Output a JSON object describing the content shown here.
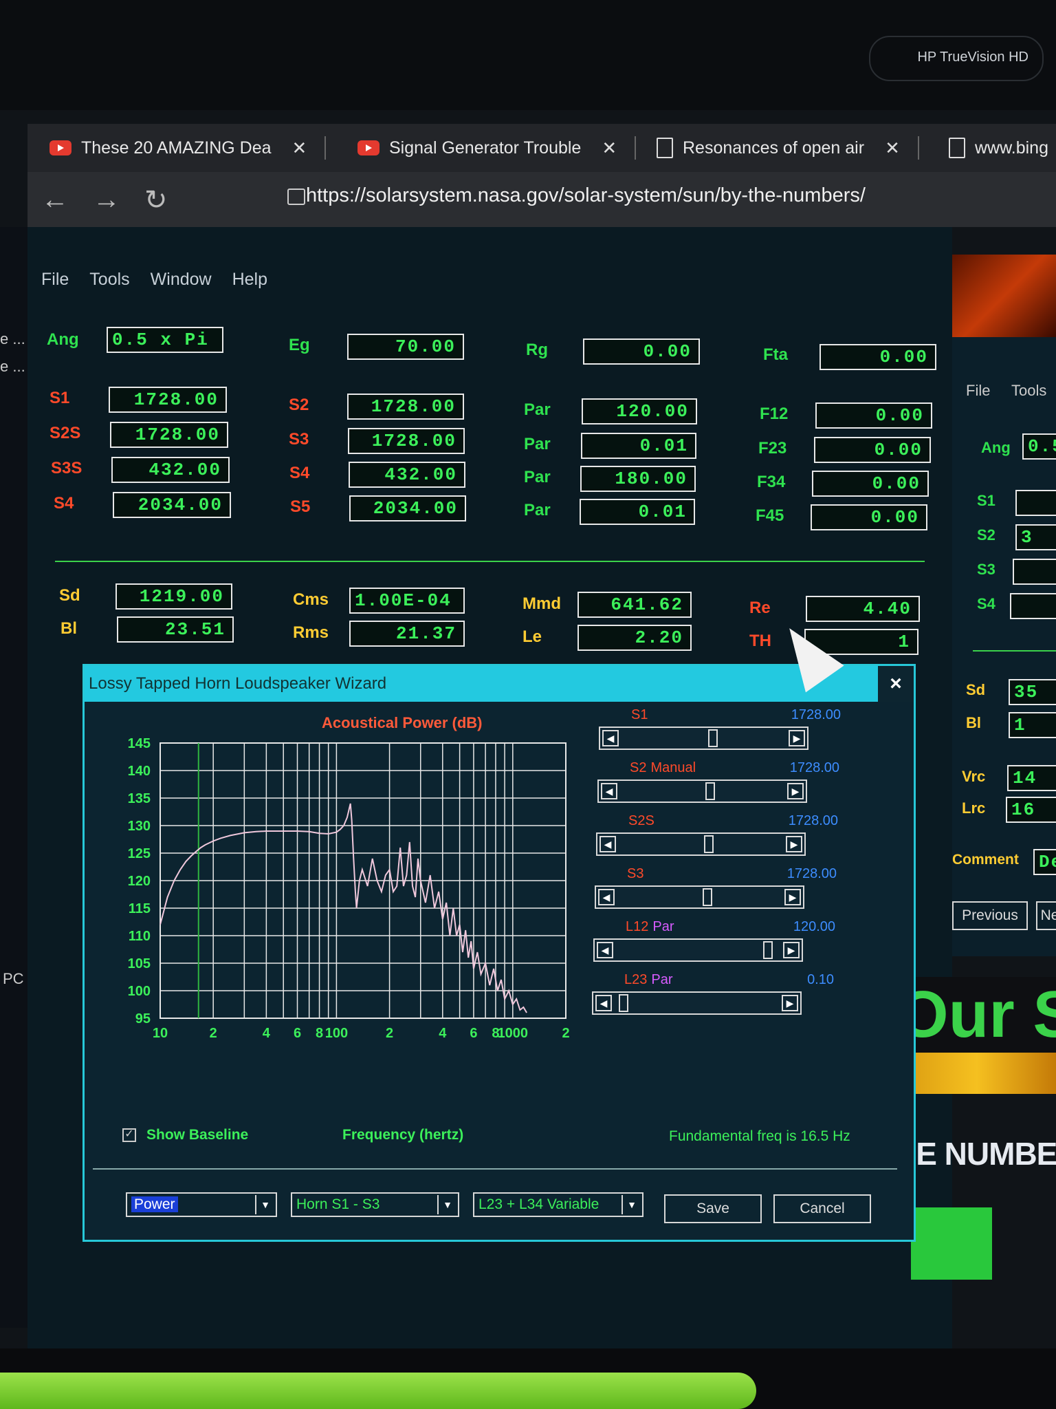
{
  "monitor": {
    "camera_label": "HP TrueVision HD"
  },
  "browser": {
    "tabs": [
      {
        "title": "These 20 AMAZING Dea"
      },
      {
        "title": "Signal Generator Trouble"
      },
      {
        "title": "Resonances of open air"
      },
      {
        "title": "www.bing"
      }
    ],
    "url": "https://solarsystem.nasa.gov/solar-system/sun/by-the-numbers/"
  },
  "left_strip": {
    "texts": [
      "e ...",
      "e ...",
      "PC"
    ]
  },
  "main_app": {
    "menu": [
      "File",
      "Tools",
      "Window",
      "Help"
    ],
    "params_row0": [
      {
        "label": "Ang",
        "value": "0.5 x Pi"
      },
      {
        "label": "Eg",
        "value": "70.00"
      },
      {
        "label": "Rg",
        "value": "0.00"
      },
      {
        "label": "Fta",
        "value": "0.00"
      }
    ],
    "col1": [
      {
        "label": "S1",
        "value": "1728.00"
      },
      {
        "label": "S2S",
        "value": "1728.00"
      },
      {
        "label": "S3S",
        "value": "432.00"
      },
      {
        "label": "S4",
        "value": "2034.00"
      }
    ],
    "col2": [
      {
        "label": "S2",
        "value": "1728.00"
      },
      {
        "label": "S3",
        "value": "1728.00"
      },
      {
        "label": "S4",
        "value": "432.00"
      },
      {
        "label": "S5",
        "value": "2034.00"
      }
    ],
    "col3": [
      {
        "label": "Par",
        "value": "120.00"
      },
      {
        "label": "Par",
        "value": "0.01"
      },
      {
        "label": "Par",
        "value": "180.00"
      },
      {
        "label": "Par",
        "value": "0.01"
      }
    ],
    "col4": [
      {
        "label": "F12",
        "value": "0.00"
      },
      {
        "label": "F23",
        "value": "0.00"
      },
      {
        "label": "F34",
        "value": "0.00"
      },
      {
        "label": "F45",
        "value": "0.00"
      }
    ],
    "driver": [
      {
        "label": "Sd",
        "value": "1219.00"
      },
      {
        "label": "Bl",
        "value": "23.51"
      },
      {
        "label": "Cms",
        "value": "1.00E-04"
      },
      {
        "label": "Rms",
        "value": "21.37"
      },
      {
        "label": "Mmd",
        "value": "641.62"
      },
      {
        "label": "Le",
        "value": "2.20"
      },
      {
        "label": "Re",
        "value": "4.40"
      },
      {
        "label": "TH",
        "value": "1"
      }
    ]
  },
  "right_app": {
    "menu": [
      "File",
      "Tools"
    ],
    "labels": [
      "Ang",
      "S1",
      "S2",
      "S3",
      "S4",
      "Sd",
      "Bl",
      "Vrc",
      "Lrc",
      "Comment"
    ],
    "values": [
      "0.5",
      "",
      "3",
      "",
      "",
      "35",
      "1",
      "14",
      "16",
      "De"
    ],
    "buttons": [
      "Previous",
      "Ne"
    ]
  },
  "website": {
    "banner": "Our S",
    "heading": "HE NUMBER"
  },
  "dialog": {
    "title": "Lossy Tapped Horn Loudspeaker Wizard",
    "close": "×",
    "show_baseline_label": "Show Baseline",
    "fundamental": "Fundamental freq is 16.5 Hz",
    "sliders": [
      {
        "label": "S1",
        "extra": "",
        "value": "1728.00",
        "position": 0.55
      },
      {
        "label": "S2",
        "extra": "Manual",
        "value": "1728.00",
        "position": 0.54
      },
      {
        "label": "S2S",
        "extra": "",
        "value": "1728.00",
        "position": 0.54
      },
      {
        "label": "S3",
        "extra": "",
        "value": "1728.00",
        "position": 0.54
      },
      {
        "label": "L12",
        "extra": "Par",
        "value": "120.00",
        "position": 0.93
      },
      {
        "label": "L23",
        "extra": "Par",
        "value": "0.10",
        "position": 0.03
      }
    ],
    "combos": [
      {
        "value": "Power"
      },
      {
        "value": "Horn S1 - S3"
      },
      {
        "value": "L23 + L34 Variable"
      }
    ],
    "save_label": "Save",
    "cancel_label": "Cancel"
  },
  "chart_data": {
    "type": "line",
    "title": "Acoustical Power (dB)",
    "xlabel": "Frequency (hertz)",
    "ylabel": "",
    "x_scale": "log",
    "xlim": [
      10,
      2000
    ],
    "ylim": [
      95,
      145
    ],
    "y_ticks": [
      145,
      140,
      135,
      130,
      125,
      120,
      115,
      110,
      105,
      100,
      95
    ],
    "x_tick_labels": [
      "10",
      "2",
      "4",
      "6",
      "8",
      "100",
      "2",
      "4",
      "6",
      "8",
      "1000",
      "2"
    ],
    "x_tick_values": [
      10,
      20,
      40,
      60,
      80,
      100,
      200,
      400,
      600,
      800,
      1000,
      2000
    ],
    "baseline_x": 16.5,
    "series": [
      {
        "x": [
          10,
          11,
          12,
          13,
          14,
          15,
          16,
          17,
          18,
          20,
          22,
          25,
          30,
          35,
          40,
          50,
          60,
          70,
          80,
          90,
          100,
          105,
          110,
          115,
          118,
          120,
          122,
          125,
          128,
          130,
          135,
          140,
          150,
          160,
          170,
          180,
          190,
          200,
          210,
          220,
          230,
          240,
          250,
          260,
          270,
          280,
          290,
          300,
          320,
          340,
          360,
          380,
          400,
          420,
          440,
          460,
          480,
          500,
          520,
          540,
          560,
          580,
          600,
          630,
          660,
          700,
          740,
          780,
          820,
          860,
          900,
          950,
          1000,
          1050,
          1100,
          1150,
          1200
        ],
        "values": [
          112,
          117,
          120,
          122,
          123.5,
          124.5,
          125.3,
          126,
          126.5,
          127.2,
          127.7,
          128.2,
          128.7,
          128.9,
          129,
          129,
          129,
          128.9,
          128.6,
          128.5,
          128.8,
          129.3,
          130,
          131.5,
          133,
          134,
          131,
          124,
          118,
          115,
          120,
          122,
          119,
          124,
          120,
          118,
          121,
          122,
          118,
          119,
          126,
          119,
          121,
          127,
          119,
          117,
          124,
          120,
          116,
          121,
          115,
          118,
          113,
          116,
          110,
          115,
          110,
          112,
          107,
          111,
          106,
          109,
          104,
          107,
          103,
          105,
          101,
          104,
          100,
          102,
          98.5,
          100,
          97.5,
          98.5,
          96.5,
          97,
          96
        ]
      }
    ]
  }
}
